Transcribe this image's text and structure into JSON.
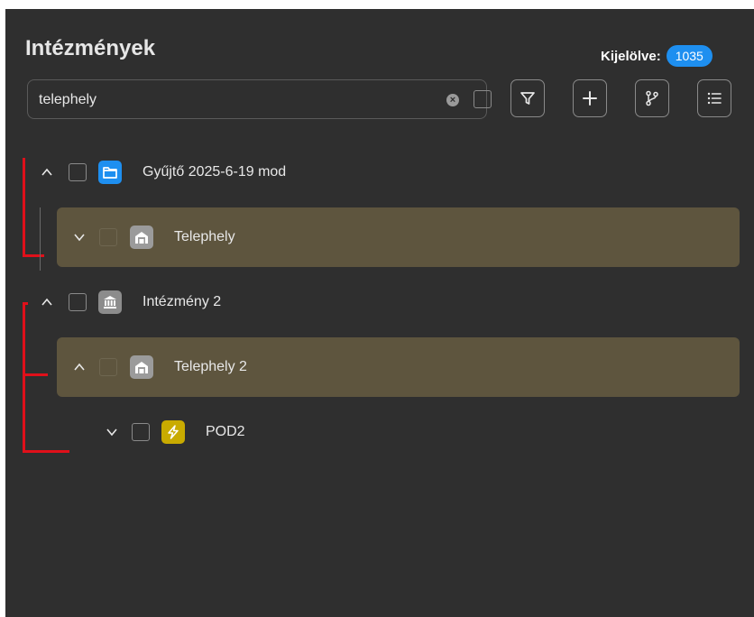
{
  "header": {
    "title": "Intézmények",
    "selected_label": "Kijelölve:",
    "selected_count": "1035"
  },
  "search": {
    "value": "telephely",
    "placeholder": ""
  },
  "toolbar": {
    "icons": [
      "filter-icon",
      "plus-icon",
      "branch-icon",
      "list-icon"
    ]
  },
  "tree": [
    {
      "label": "Gyűjtő 2025-6-19 mod",
      "icon": "folder-icon",
      "expanded": true,
      "highlighted": false
    },
    {
      "label": "Telephely",
      "icon": "warehouse-icon",
      "expanded": false,
      "highlighted": true
    },
    {
      "label": "Intézmény 2",
      "icon": "institution-icon",
      "expanded": true,
      "highlighted": false
    },
    {
      "label": "Telephely 2",
      "icon": "warehouse-icon",
      "expanded": true,
      "highlighted": true
    },
    {
      "label": "POD2",
      "icon": "lightning-icon",
      "expanded": false,
      "highlighted": false
    }
  ],
  "colors": {
    "background": "#2f2f2f",
    "highlight": "#5e553e",
    "accent": "#1e8ff0",
    "folder": "#1e8ff0",
    "gray_icon": "#8c8c8c",
    "pod_icon": "#c9ab00",
    "annotation": "#e0101a"
  }
}
